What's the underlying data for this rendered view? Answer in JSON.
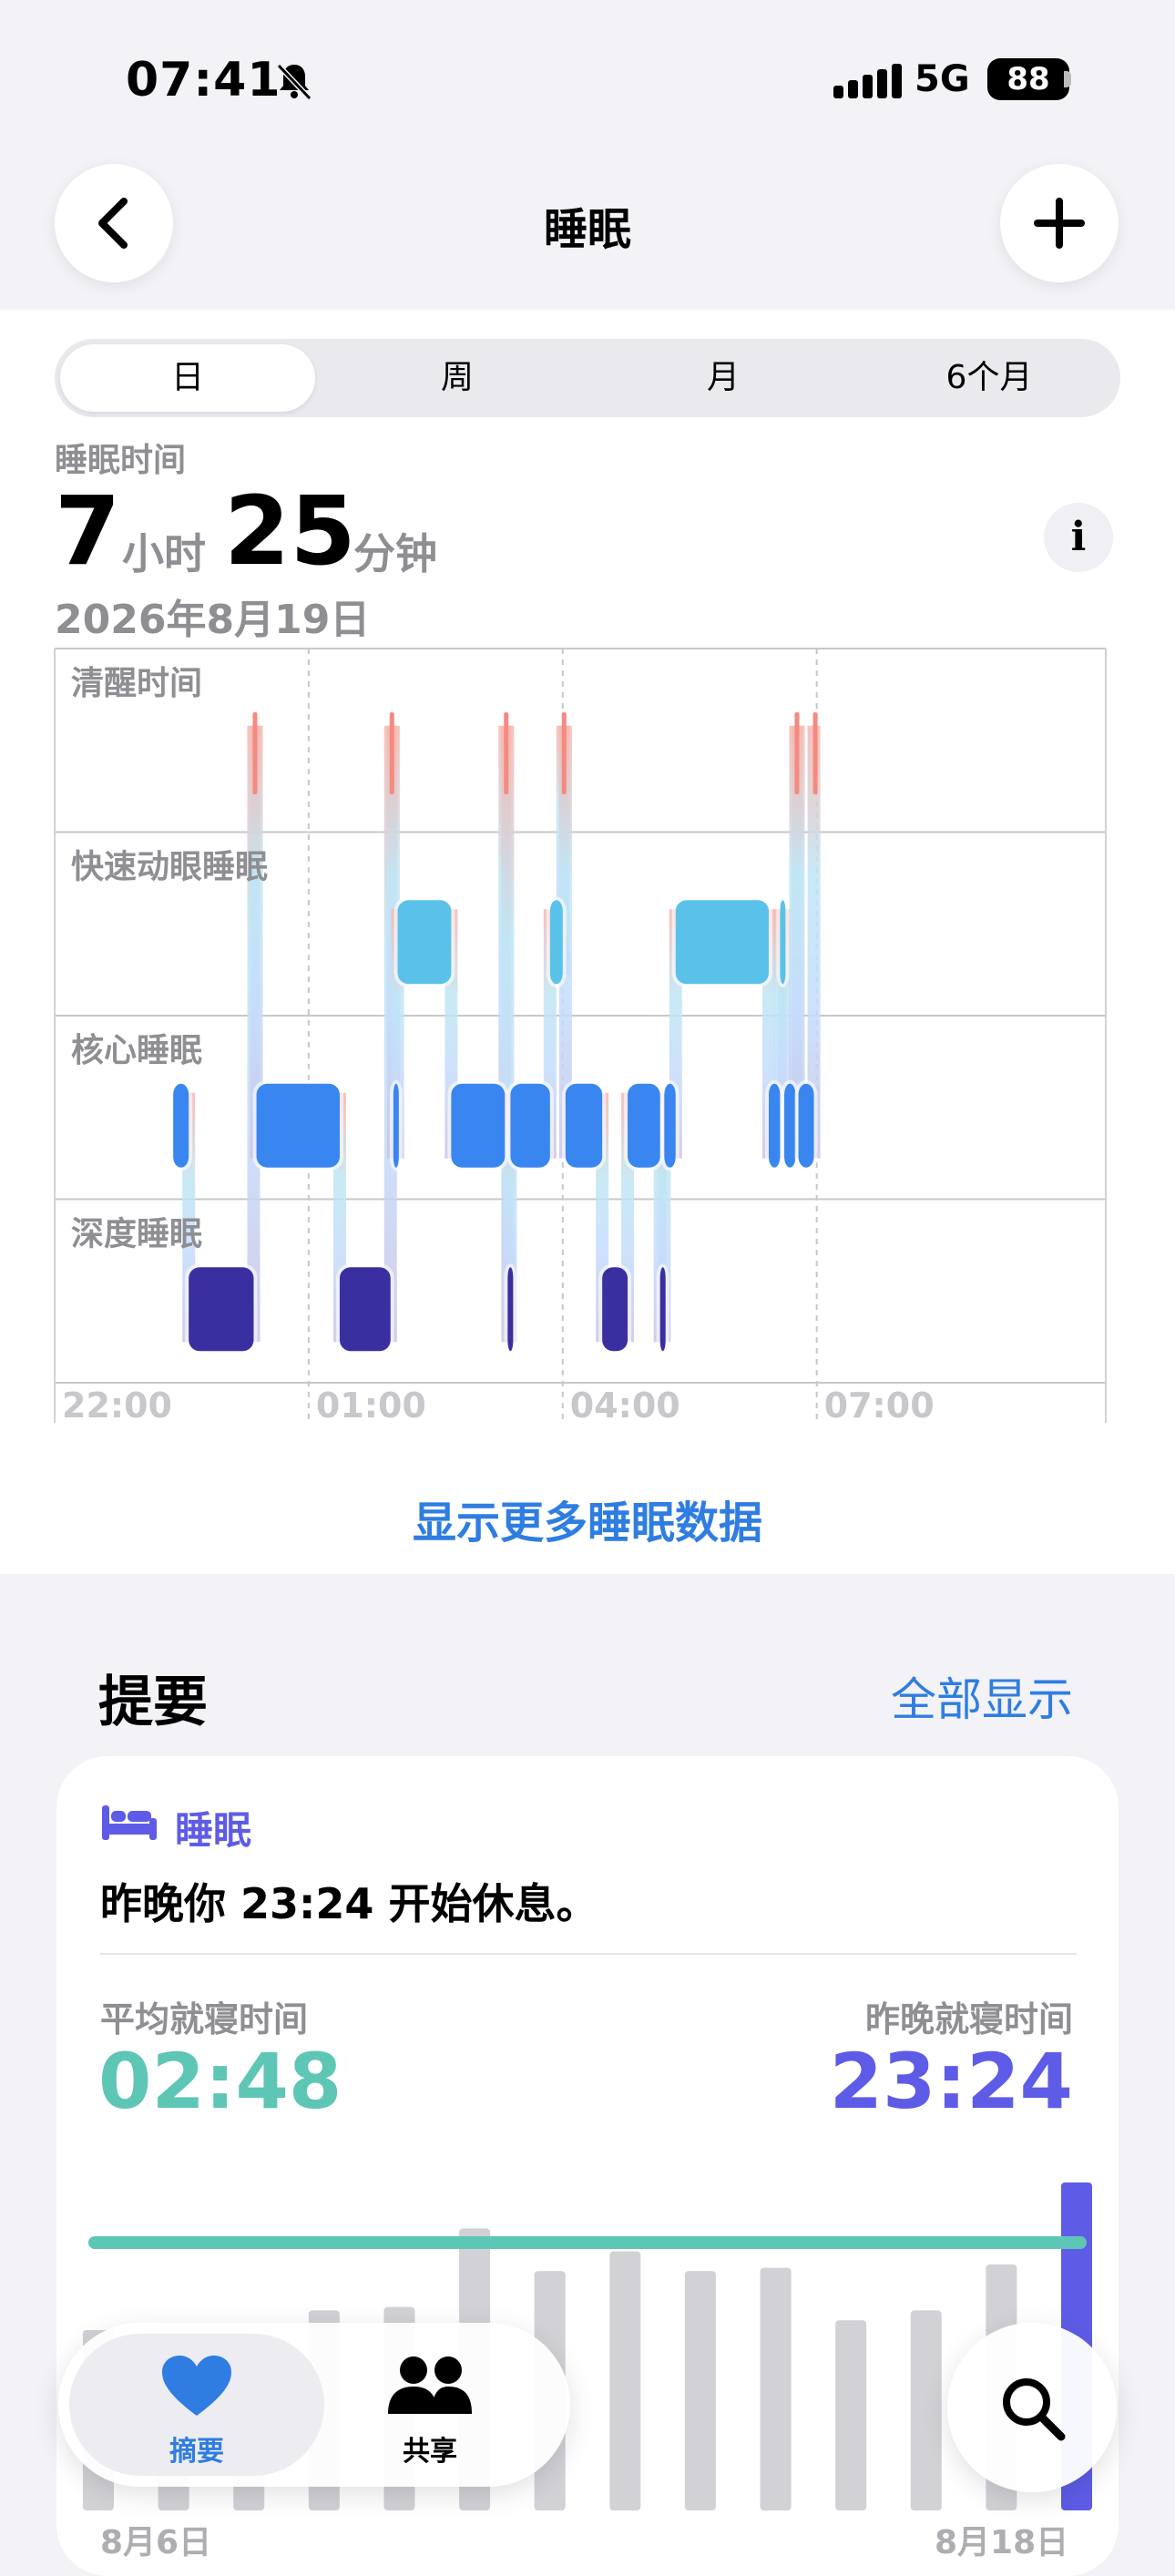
{
  "status_bar": {
    "time": "07:41",
    "network": "5G",
    "battery": "88"
  },
  "nav": {
    "title": "睡眠"
  },
  "segments": {
    "items": [
      "日",
      "周",
      "月",
      "6个月"
    ],
    "selected": "日"
  },
  "summary": {
    "label": "睡眠时间",
    "hours": "7",
    "hours_unit": "小时",
    "minutes": "25",
    "minutes_unit": "分钟",
    "date": "2026年8月19日"
  },
  "chart_data": {
    "type": "hypnogram",
    "stages": [
      "清醒时间",
      "快速动眼睡眠",
      "核心睡眠",
      "深度睡眠"
    ],
    "stage_colors": {
      "清醒时间": "#f58a80",
      "快速动眼睡眠": "#5ac2e8",
      "核心睡眠": "#3a86f0",
      "深度睡眠": "#3a2fa0"
    },
    "x_ticks": [
      "22:00",
      "01:00",
      "04:00",
      "07:00"
    ],
    "segments": [
      {
        "stage": "核心睡眠",
        "start": "23:24",
        "end": "23:35"
      },
      {
        "stage": "深度睡眠",
        "start": "23:35",
        "end": "00:21"
      },
      {
        "stage": "清醒时间",
        "start": "00:21",
        "end": "00:23"
      },
      {
        "stage": "核心睡眠",
        "start": "00:23",
        "end": "01:22"
      },
      {
        "stage": "深度睡眠",
        "start": "01:22",
        "end": "01:58"
      },
      {
        "stage": "清醒时间",
        "start": "01:58",
        "end": "02:00"
      },
      {
        "stage": "核心睡眠",
        "start": "02:00",
        "end": "02:03"
      },
      {
        "stage": "快速动眼睡眠",
        "start": "02:03",
        "end": "02:41"
      },
      {
        "stage": "核心睡眠",
        "start": "02:41",
        "end": "03:19"
      },
      {
        "stage": "清醒时间",
        "start": "03:19",
        "end": "03:21"
      },
      {
        "stage": "深度睡眠",
        "start": "03:21",
        "end": "03:23"
      },
      {
        "stage": "核心睡眠",
        "start": "03:23",
        "end": "03:51"
      },
      {
        "stage": "快速动眼睡眠",
        "start": "03:51",
        "end": "04:00"
      },
      {
        "stage": "清醒时间",
        "start": "04:00",
        "end": "04:02"
      },
      {
        "stage": "核心睡眠",
        "start": "04:02",
        "end": "04:28"
      },
      {
        "stage": "深度睡眠",
        "start": "04:28",
        "end": "04:46"
      },
      {
        "stage": "核心睡眠",
        "start": "04:46",
        "end": "05:09"
      },
      {
        "stage": "深度睡眠",
        "start": "05:09",
        "end": "05:12"
      },
      {
        "stage": "核心睡眠",
        "start": "05:12",
        "end": "05:20"
      },
      {
        "stage": "快速动眼睡眠",
        "start": "05:20",
        "end": "06:26"
      },
      {
        "stage": "核心睡眠",
        "start": "06:26",
        "end": "06:34"
      },
      {
        "stage": "快速动眼睡眠",
        "start": "06:34",
        "end": "06:37"
      },
      {
        "stage": "核心睡眠",
        "start": "06:37",
        "end": "06:45"
      },
      {
        "stage": "清醒时间",
        "start": "06:45",
        "end": "06:47"
      },
      {
        "stage": "核心睡眠",
        "start": "06:47",
        "end": "06:58"
      },
      {
        "stage": "清醒时间",
        "start": "06:58",
        "end": "07:00"
      }
    ]
  },
  "more_link": "显示更多睡眠数据",
  "highlights": {
    "title": "提要",
    "show_all": "全部显示",
    "card": {
      "category": "睡眠",
      "message": "昨晚你 23:24 开始休息。",
      "avg_label": "平均就寝时间",
      "avg_value": "02:48",
      "last_label": "昨晚就寝时间",
      "last_value": "23:24",
      "accent_avg": "#5ec6b5",
      "accent_last": "#5e5ce6",
      "start_date": "8月6日",
      "end_date": "8月18日"
    },
    "bedtime_chart": {
      "type": "bar",
      "average_bedtime": "02:48",
      "bars": [
        0.55,
        0.46,
        0.28,
        0.61,
        0.62,
        0.86,
        0.73,
        0.79,
        0.73,
        0.74,
        0.58,
        0.61,
        0.75,
        1.0
      ]
    }
  },
  "tabs": {
    "summary": "摘要",
    "sharing": "共享"
  }
}
